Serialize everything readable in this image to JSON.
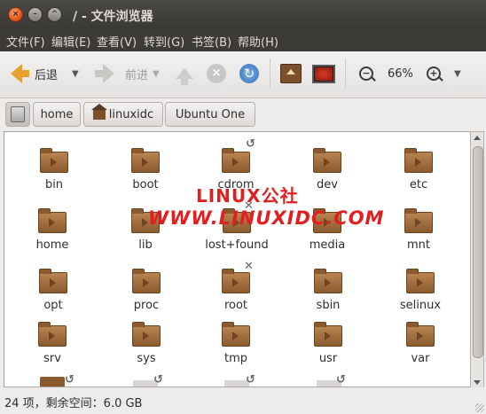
{
  "window": {
    "title": "/ - 文件浏览器",
    "buttons": {
      "close": "×",
      "minimize": "–",
      "maximize": "^"
    }
  },
  "menu": [
    "文件(F)",
    "编辑(E)",
    "查看(V)",
    "转到(G)",
    "书签(B)",
    "帮助(H)"
  ],
  "toolbar": {
    "back_label": "后退",
    "forward_label": "前进",
    "zoom_level": "66%",
    "icons": [
      "back-arrow-icon",
      "forward-arrow-icon",
      "up-icon",
      "stop-icon",
      "reload-icon",
      "home-icon",
      "computer-icon",
      "zoom-out-icon",
      "zoom-in-icon"
    ]
  },
  "pathbar": [
    "home",
    "linuxidc",
    "Ubuntu One"
  ],
  "files": [
    {
      "name": "bin"
    },
    {
      "name": "boot"
    },
    {
      "name": "cdrom"
    },
    {
      "name": "dev"
    },
    {
      "name": "etc"
    },
    {
      "name": "home"
    },
    {
      "name": "lib"
    },
    {
      "name": "lost+found"
    },
    {
      "name": "media"
    },
    {
      "name": "mnt"
    },
    {
      "name": "opt"
    },
    {
      "name": "proc"
    },
    {
      "name": "root"
    },
    {
      "name": "sbin"
    },
    {
      "name": "selinux"
    },
    {
      "name": "srv"
    },
    {
      "name": "sys"
    },
    {
      "name": "tmp"
    },
    {
      "name": "usr"
    },
    {
      "name": "var"
    }
  ],
  "watermark": {
    "line1": "LINUX公社",
    "line2": "WWW.LINUXIDC.COM"
  },
  "status": "24 项，剩余空间：6.0 GB",
  "colors": {
    "titlebar": "#3c3b37",
    "folder": "#8b5a2e",
    "accent_orange": "#e7a12e"
  }
}
